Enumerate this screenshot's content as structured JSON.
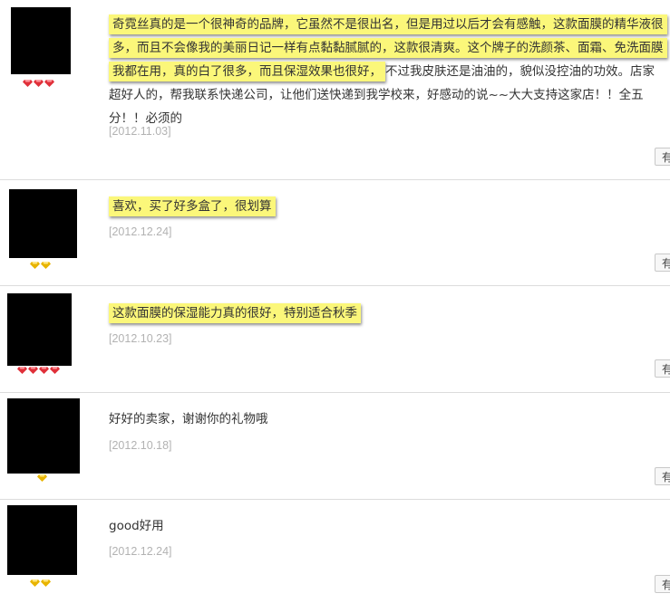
{
  "reviews": [
    {
      "segments": [
        {
          "text": "奇霓丝真的是一个很神奇的品牌，它虽然不是很出名，但是用过以后才会有感触，这款面膜的精华液很多，而且不会像我的美丽日记一样有点黏黏腻腻的，这款很清爽。这个牌子的洗颜茶、面霜、免洗面膜我都在用，真的白了很多，而且保湿效果也很好，",
          "highlight": true
        },
        {
          "text": "不过我皮肤还是油油的，貌似没控油的功效。店家超好人的，帮我联系快递公司，让他们送快递到我学校来，好感动的说~~大大支持这家店！！全五分！！必须的",
          "highlight": false
        }
      ],
      "date": "[2012.11.03]",
      "badge_type": "red-gem",
      "badge_count": 3,
      "button_label": "有用"
    },
    {
      "segments": [
        {
          "text": "喜欢，买了好多盒了，很划算",
          "highlight": true
        }
      ],
      "date": "[2012.12.24]",
      "badge_type": "gold-gem",
      "badge_count": 2,
      "button_label": "有用"
    },
    {
      "segments": [
        {
          "text": "这款面膜的保湿能力真的很好，特别适合秋季",
          "highlight": true
        }
      ],
      "date": "[2012.10.23]",
      "badge_type": "red-gem",
      "badge_count": 4,
      "button_label": "有用"
    },
    {
      "segments": [
        {
          "text": "好好的卖家，谢谢你的礼物哦",
          "highlight": false
        }
      ],
      "date": "[2012.10.18]",
      "badge_type": "gold-gem",
      "badge_count": 1,
      "button_label": "有用"
    },
    {
      "segments": [
        {
          "text": "good好用",
          "highlight": false
        }
      ],
      "date": "[2012.12.24]",
      "badge_type": "gold-gem",
      "badge_count": 2,
      "button_label": "有用"
    }
  ],
  "colors": {
    "highlight": "#fbf77a",
    "red_gem": "#e0303a",
    "gold_gem": "#e8b400",
    "date": "#b2b2b2",
    "divider": "#dcdcdc"
  }
}
